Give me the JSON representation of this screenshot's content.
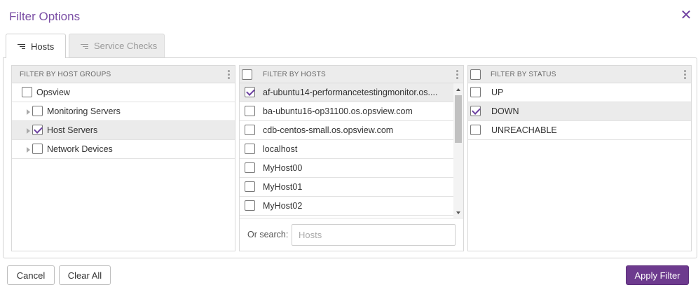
{
  "dialog": {
    "title": "Filter Options",
    "close_glyph": "✕"
  },
  "tabs": [
    {
      "label": "Hosts",
      "active": true
    },
    {
      "label": "Service Checks",
      "active": false
    }
  ],
  "host_groups": {
    "header": "FILTER BY HOST GROUPS",
    "items": [
      {
        "label": "Opsview",
        "checked": false,
        "expandable": false,
        "selected": false
      },
      {
        "label": "Monitoring Servers",
        "checked": false,
        "expandable": true,
        "selected": false
      },
      {
        "label": "Host Servers",
        "checked": true,
        "expandable": true,
        "selected": true
      },
      {
        "label": "Network Devices",
        "checked": false,
        "expandable": true,
        "selected": false
      }
    ]
  },
  "hosts": {
    "header": "FILTER BY HOSTS",
    "items": [
      {
        "label": "af-ubuntu14-performancetestingmonitor.os....",
        "checked": true,
        "selected": true
      },
      {
        "label": "ba-ubuntu16-op31100.os.opsview.com",
        "checked": false,
        "selected": false
      },
      {
        "label": "cdb-centos-small.os.opsview.com",
        "checked": false,
        "selected": false
      },
      {
        "label": "localhost",
        "checked": false,
        "selected": false
      },
      {
        "label": "MyHost00",
        "checked": false,
        "selected": false
      },
      {
        "label": "MyHost01",
        "checked": false,
        "selected": false
      },
      {
        "label": "MyHost02",
        "checked": false,
        "selected": false
      }
    ],
    "search_label": "Or search:",
    "search_placeholder": "Hosts",
    "search_value": ""
  },
  "status": {
    "header": "FILTER BY STATUS",
    "items": [
      {
        "label": "UP",
        "checked": false,
        "selected": false
      },
      {
        "label": "DOWN",
        "checked": true,
        "selected": true
      },
      {
        "label": "UNREACHABLE",
        "checked": false,
        "selected": false
      }
    ]
  },
  "footer": {
    "cancel_label": "Cancel",
    "clear_label": "Clear All",
    "apply_label": "Apply Filter"
  },
  "colors": {
    "accent": "#6d3a8e",
    "title": "#7b4fa5",
    "selected_row": "#ebebeb"
  },
  "icons": {
    "tab_icon": "filter-lines-icon",
    "close": "close-icon",
    "menu": "kebab-menu-icon"
  }
}
